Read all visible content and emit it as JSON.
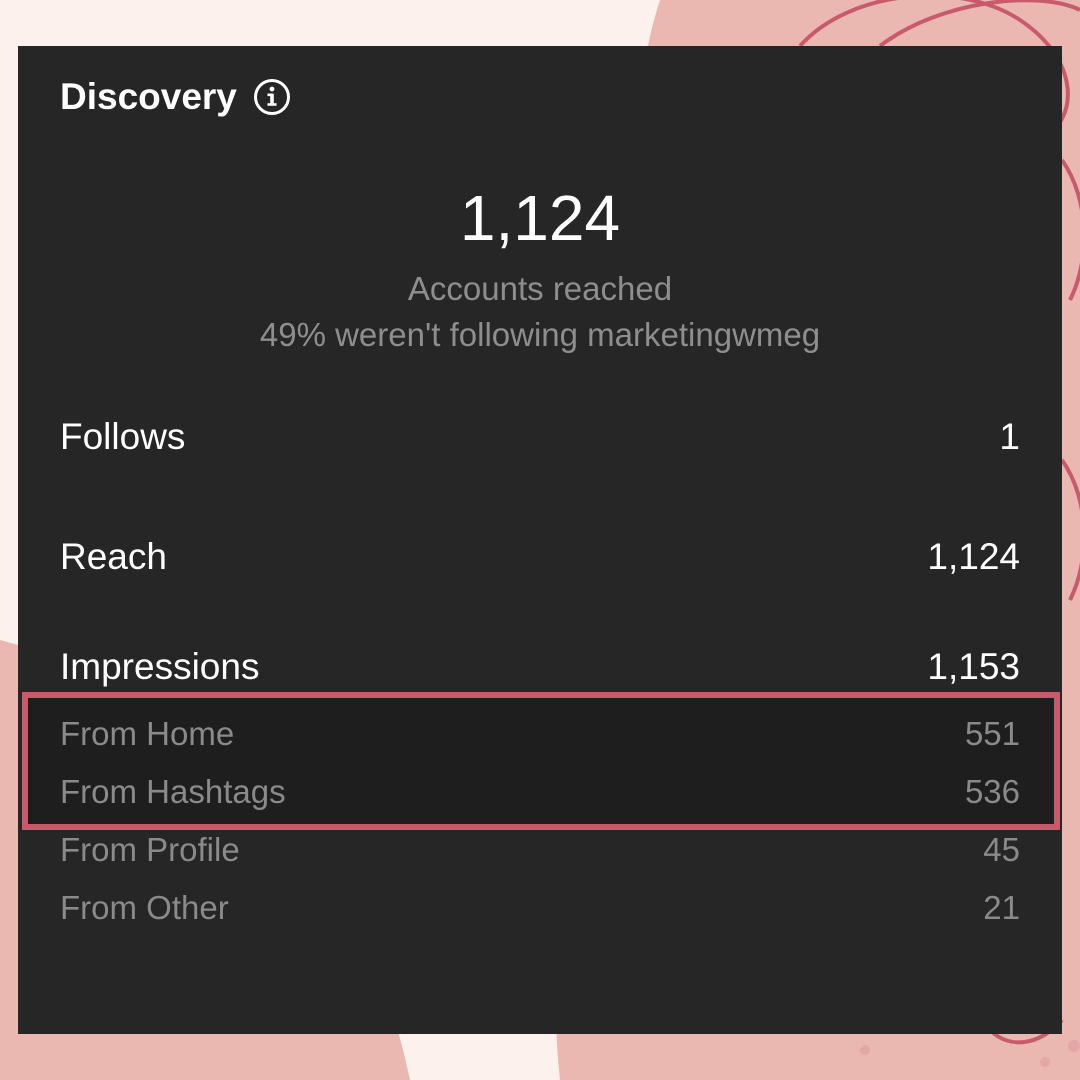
{
  "colors": {
    "page_bg": "#fcf1ec",
    "blob": "#ebb8b1",
    "accent_line": "#c85b6b",
    "panel_bg": "#262626",
    "primary_text": "#ffffff",
    "secondary_text": "#8e8e8e"
  },
  "discovery": {
    "title": "Discovery",
    "info_icon": "info-circle-icon",
    "accounts_reached_value": "1,124",
    "accounts_reached_label": "Accounts reached",
    "non_followers_note": "49% weren't following marketingwmeg"
  },
  "stats": [
    {
      "label": "Follows",
      "value": "1"
    },
    {
      "label": "Reach",
      "value": "1,124"
    },
    {
      "label": "Impressions",
      "value": "1,153"
    }
  ],
  "impression_sources": [
    {
      "label": "From Home",
      "value": "551",
      "highlighted": true
    },
    {
      "label": "From Hashtags",
      "value": "536",
      "highlighted": true
    },
    {
      "label": "From Profile",
      "value": "45",
      "highlighted": false
    },
    {
      "label": "From Other",
      "value": "21",
      "highlighted": false
    }
  ]
}
